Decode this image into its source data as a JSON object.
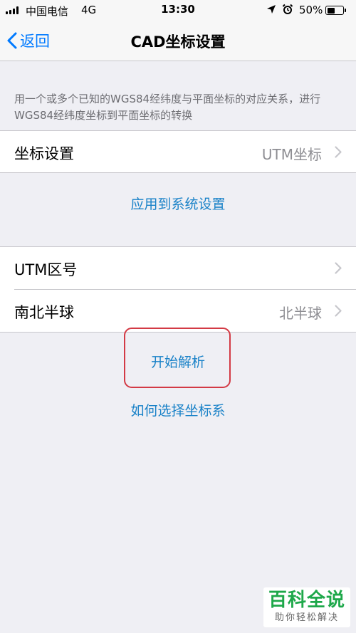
{
  "status_bar": {
    "carrier": "中国电信",
    "network": "4G",
    "time": "13:30",
    "battery": "50%",
    "battery_level": 0.5
  },
  "nav": {
    "back_label": "返回",
    "title": "CAD坐标设置"
  },
  "description": "用一个或多个已知的WGS84经纬度与平面坐标的对应关系，进行WGS84经纬度坐标到平面坐标的转换",
  "coord_setting": {
    "label": "坐标设置",
    "value": "UTM坐标"
  },
  "apply_label": "应用到系统设置",
  "utm_zone": {
    "label": "UTM区号",
    "value": ""
  },
  "hemisphere": {
    "label": "南北半球",
    "value": "北半球"
  },
  "start_parse_label": "开始解析",
  "how_to_choose_label": "如何选择坐标系",
  "watermark": {
    "main": "百科全说",
    "sub": "助你轻松解决"
  },
  "colors": {
    "accent": "#007aff",
    "link": "#1a82c8",
    "highlight": "#d33a45",
    "watermark": "#1ea84a",
    "background": "#efeff4"
  },
  "icons": [
    "signal-icon",
    "location-arrow-icon",
    "alarm-clock-icon",
    "battery-icon",
    "chevron-left-icon",
    "chevron-right-icon"
  ]
}
